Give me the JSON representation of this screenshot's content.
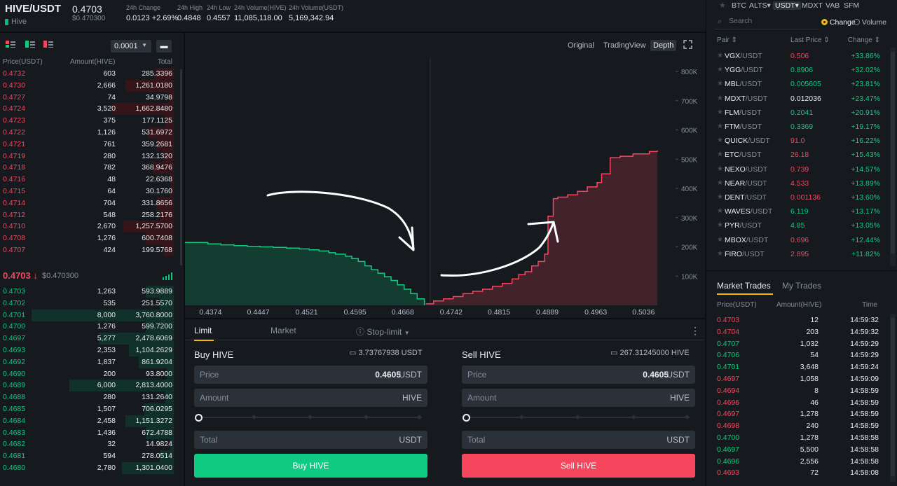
{
  "header": {
    "symbol": "HIVE/USDT",
    "coin_name": "Hive",
    "last_price": "0.4703",
    "last_price_usd": "$0.470300",
    "stats": [
      {
        "label": "24h Change",
        "value": "0.0123 +2.69%",
        "color": "#0ecb81"
      },
      {
        "label": "24h High",
        "value": "0.4848",
        "color": "#eaecef"
      },
      {
        "label": "24h Low",
        "value": "0.4557",
        "color": "#eaecef"
      },
      {
        "label": "24h Volume(HIVE)",
        "value": "11,085,118.00",
        "color": "#eaecef"
      },
      {
        "label": "24h Volume(USDT)",
        "value": "5,169,342.94",
        "color": "#eaecef"
      }
    ]
  },
  "orderbook": {
    "precision": "0.0001",
    "headers": {
      "price": "Price(USDT)",
      "amount": "Amount(HIVE)",
      "total": "Total"
    },
    "asks": [
      {
        "price": "0.4732",
        "amount": "603",
        "total": "285.3396",
        "depth": 0.11
      },
      {
        "price": "0.4730",
        "amount": "2,666",
        "total": "1,261.0180",
        "depth": 0.28
      },
      {
        "price": "0.4727",
        "amount": "74",
        "total": "34.9798",
        "depth": 0.03
      },
      {
        "price": "0.4724",
        "amount": "3,520",
        "total": "1,662.8480",
        "depth": 0.36
      },
      {
        "price": "0.4723",
        "amount": "375",
        "total": "177.1125",
        "depth": 0.05
      },
      {
        "price": "0.4722",
        "amount": "1,126",
        "total": "531.6972",
        "depth": 0.15
      },
      {
        "price": "0.4721",
        "amount": "761",
        "total": "359.2681",
        "depth": 0.1
      },
      {
        "price": "0.4719",
        "amount": "280",
        "total": "132.1320",
        "depth": 0.06
      },
      {
        "price": "0.4718",
        "amount": "782",
        "total": "368.9476",
        "depth": 0.12
      },
      {
        "price": "0.4716",
        "amount": "48",
        "total": "22.6368",
        "depth": 0.02
      },
      {
        "price": "0.4715",
        "amount": "64",
        "total": "30.1760",
        "depth": 0.02
      },
      {
        "price": "0.4714",
        "amount": "704",
        "total": "331.8656",
        "depth": 0.1
      },
      {
        "price": "0.4712",
        "amount": "548",
        "total": "258.2176",
        "depth": 0.08
      },
      {
        "price": "0.4710",
        "amount": "2,670",
        "total": "1,257.5700",
        "depth": 0.29
      },
      {
        "price": "0.4708",
        "amount": "1,276",
        "total": "600.7408",
        "depth": 0.16
      },
      {
        "price": "0.4707",
        "amount": "424",
        "total": "199.5768",
        "depth": 0.06
      }
    ],
    "mid_price": "0.4703",
    "mid_arrow": "↓",
    "mid_usd": "$0.470300",
    "bids": [
      {
        "price": "0.4703",
        "amount": "1,263",
        "total": "593.9889",
        "depth": 0.16
      },
      {
        "price": "0.4702",
        "amount": "535",
        "total": "251.5570",
        "depth": 0.08
      },
      {
        "price": "0.4701",
        "amount": "8,000",
        "total": "3,760.8000",
        "depth": 0.82
      },
      {
        "price": "0.4700",
        "amount": "1,276",
        "total": "599.7200",
        "depth": 0.16
      },
      {
        "price": "0.4697",
        "amount": "5,277",
        "total": "2,478.6069",
        "depth": 0.43
      },
      {
        "price": "0.4693",
        "amount": "2,353",
        "total": "1,104.2629",
        "depth": 0.26
      },
      {
        "price": "0.4692",
        "amount": "1,837",
        "total": "861.9204",
        "depth": 0.2
      },
      {
        "price": "0.4690",
        "amount": "200",
        "total": "93.8000",
        "depth": 0.04
      },
      {
        "price": "0.4689",
        "amount": "6,000",
        "total": "2,813.4000",
        "depth": 0.6
      },
      {
        "price": "0.4688",
        "amount": "280",
        "total": "131.2640",
        "depth": 0.05
      },
      {
        "price": "0.4685",
        "amount": "1,507",
        "total": "706.0295",
        "depth": 0.17
      },
      {
        "price": "0.4684",
        "amount": "2,458",
        "total": "1,151.3272",
        "depth": 0.28
      },
      {
        "price": "0.4683",
        "amount": "1,436",
        "total": "672.4788",
        "depth": 0.16
      },
      {
        "price": "0.4682",
        "amount": "32",
        "total": "14.9824",
        "depth": 0.02
      },
      {
        "price": "0.4681",
        "amount": "594",
        "total": "278.0514",
        "depth": 0.08
      },
      {
        "price": "0.4680",
        "amount": "2,780",
        "total": "1,301.0400",
        "depth": 0.3
      }
    ]
  },
  "chart_tabs": [
    "Original",
    "TradingView",
    "Depth"
  ],
  "chart_data": {
    "type": "area",
    "x_ticks": [
      "0.4374",
      "0.4447",
      "0.4521",
      "0.4595",
      "0.4668",
      "0.4742",
      "0.4815",
      "0.4889",
      "0.4963",
      "0.5036"
    ],
    "y_ticks": [
      "100K",
      "200K",
      "300K",
      "400K",
      "500K",
      "600K",
      "700K",
      "800K"
    ],
    "xlim": [
      0.4335,
      0.5085
    ],
    "ylim": [
      0,
      860000
    ],
    "series": [
      {
        "side": "bid",
        "color": "#0ecb81",
        "x": [
          0.4335,
          0.437,
          0.439,
          0.441,
          0.443,
          0.445,
          0.447,
          0.449,
          0.451,
          0.4525,
          0.454,
          0.4555,
          0.4565,
          0.458,
          0.459,
          0.46,
          0.461,
          0.462,
          0.463,
          0.464,
          0.465,
          0.466,
          0.467,
          0.468,
          0.469,
          0.4701
        ],
        "y": [
          215000,
          210000,
          207000,
          204000,
          202000,
          200000,
          198000,
          196000,
          193000,
          190000,
          186000,
          180000,
          175000,
          168000,
          160000,
          150000,
          135000,
          122000,
          110000,
          98000,
          85000,
          70000,
          55000,
          40000,
          22000,
          0
        ]
      },
      {
        "side": "ask",
        "color": "#f6465d",
        "x": [
          0.4703,
          0.4715,
          0.473,
          0.4745,
          0.476,
          0.4775,
          0.479,
          0.4805,
          0.482,
          0.4835,
          0.4845,
          0.4855,
          0.4865,
          0.4875,
          0.4885,
          0.489,
          0.4898,
          0.4905,
          0.492,
          0.4935,
          0.495,
          0.4965,
          0.4972,
          0.4985,
          0.5,
          0.502,
          0.5045,
          0.5057
        ],
        "y": [
          5000,
          15000,
          22000,
          30000,
          40000,
          48000,
          55000,
          65000,
          75000,
          90000,
          105000,
          115000,
          135000,
          150000,
          175000,
          305000,
          365000,
          370000,
          378000,
          390000,
          405000,
          420000,
          450000,
          505000,
          510000,
          518000,
          526000,
          530000
        ]
      }
    ]
  },
  "order_form": {
    "tabs": [
      "Limit",
      "Market",
      "Stop-limit"
    ],
    "buy": {
      "title": "Buy HIVE",
      "balance": "3.73767938 USDT",
      "price_label": "Price",
      "price_value": "0.4605",
      "price_unit": "USDT",
      "amount_label": "Amount",
      "amount_unit": "HIVE",
      "total_label": "Total",
      "total_unit": "USDT",
      "button": "Buy HIVE"
    },
    "sell": {
      "title": "Sell HIVE",
      "balance": "267.31245000 HIVE",
      "price_label": "Price",
      "price_value": "0.4605",
      "price_unit": "USDT",
      "amount_label": "Amount",
      "amount_unit": "HIVE",
      "total_label": "Total",
      "total_unit": "USDT",
      "button": "Sell HIVE"
    }
  },
  "markets": {
    "quote_tabs": [
      "BTC",
      "ALTS▾",
      "USDT▾",
      "MDXT",
      "VAB",
      "SFM"
    ],
    "search_placeholder": "Search",
    "radio_change": "Change",
    "radio_volume": "Volume",
    "col_pair": "Pair",
    "col_last": "Last Price",
    "col_change": "Change",
    "pairs": [
      {
        "base": "VGX",
        "quote": "/USDT",
        "last": "0.506",
        "dir": "red",
        "change": "+33.86%"
      },
      {
        "base": "YGG",
        "quote": "/USDT",
        "last": "0.8906",
        "dir": "green",
        "change": "+32.02%"
      },
      {
        "base": "MBL",
        "quote": "/USDT",
        "last": "0.005605",
        "dir": "green",
        "change": "+23.81%"
      },
      {
        "base": "MDXT",
        "quote": "/USDT",
        "last": "0.012036",
        "dir": "white",
        "change": "+23.47%"
      },
      {
        "base": "FLM",
        "quote": "/USDT",
        "last": "0.2041",
        "dir": "green",
        "change": "+20.91%"
      },
      {
        "base": "FTM",
        "quote": "/USDT",
        "last": "0.3369",
        "dir": "green",
        "change": "+19.17%"
      },
      {
        "base": "QUICK",
        "quote": "/USDT",
        "last": "91.0",
        "dir": "red",
        "change": "+16.22%"
      },
      {
        "base": "ETC",
        "quote": "/USDT",
        "last": "26.18",
        "dir": "red",
        "change": "+15.43%"
      },
      {
        "base": "NEXO",
        "quote": "/USDT",
        "last": "0.739",
        "dir": "red",
        "change": "+14.57%"
      },
      {
        "base": "NEAR",
        "quote": "/USDT",
        "last": "4.533",
        "dir": "red",
        "change": "+13.89%"
      },
      {
        "base": "DENT",
        "quote": "/USDT",
        "last": "0.001136",
        "dir": "red",
        "change": "+13.60%"
      },
      {
        "base": "WAVES",
        "quote": "/USDT",
        "last": "6.119",
        "dir": "green",
        "change": "+13.17%"
      },
      {
        "base": "PYR",
        "quote": "/USDT",
        "last": "4.85",
        "dir": "green",
        "change": "+13.05%"
      },
      {
        "base": "MBOX",
        "quote": "/USDT",
        "last": "0.696",
        "dir": "red",
        "change": "+12.44%"
      },
      {
        "base": "FIRO",
        "quote": "/USDT",
        "last": "2.895",
        "dir": "red",
        "change": "+11.82%"
      }
    ]
  },
  "trades": {
    "tabs": [
      "Market Trades",
      "My Trades"
    ],
    "col_price": "Price(USDT)",
    "col_amount": "Amount(HIVE)",
    "col_time": "Time",
    "rows": [
      {
        "price": "0.4703",
        "dir": "red",
        "amount": "12",
        "time": "14:59:32"
      },
      {
        "price": "0.4704",
        "dir": "red",
        "amount": "203",
        "time": "14:59:32"
      },
      {
        "price": "0.4707",
        "dir": "green",
        "amount": "1,032",
        "time": "14:59:29"
      },
      {
        "price": "0.4706",
        "dir": "green",
        "amount": "54",
        "time": "14:59:29"
      },
      {
        "price": "0.4701",
        "dir": "green",
        "amount": "3,648",
        "time": "14:59:24"
      },
      {
        "price": "0.4697",
        "dir": "red",
        "amount": "1,058",
        "time": "14:59:09"
      },
      {
        "price": "0.4694",
        "dir": "red",
        "amount": "8",
        "time": "14:58:59"
      },
      {
        "price": "0.4696",
        "dir": "red",
        "amount": "46",
        "time": "14:58:59"
      },
      {
        "price": "0.4697",
        "dir": "red",
        "amount": "1,278",
        "time": "14:58:59"
      },
      {
        "price": "0.4698",
        "dir": "red",
        "amount": "240",
        "time": "14:58:59"
      },
      {
        "price": "0.4700",
        "dir": "green",
        "amount": "1,278",
        "time": "14:58:58"
      },
      {
        "price": "0.4697",
        "dir": "green",
        "amount": "5,500",
        "time": "14:58:58"
      },
      {
        "price": "0.4696",
        "dir": "green",
        "amount": "2,556",
        "time": "14:58:58"
      },
      {
        "price": "0.4693",
        "dir": "red",
        "amount": "72",
        "time": "14:58:08"
      }
    ]
  }
}
